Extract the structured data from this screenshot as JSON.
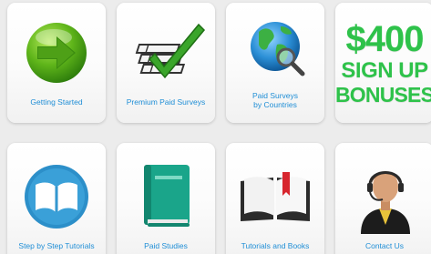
{
  "tiles_row1": [
    {
      "label": "Getting Started",
      "icon": "arrow-right-icon"
    },
    {
      "label": "Premium Paid Surveys",
      "icon": "checklist-icon"
    },
    {
      "label": "Paid Surveys\nby Countries",
      "icon": "globe-magnifier-icon"
    },
    {
      "headline": "$400",
      "line2": "SIGN UP",
      "line3": "BONUSES"
    }
  ],
  "tiles_row2": [
    {
      "label": "Step by Step Tutorials",
      "icon": "open-book-circle-icon"
    },
    {
      "label": "Paid Studies",
      "icon": "green-book-icon"
    },
    {
      "label": "Tutorials and Books",
      "icon": "bookmark-book-icon"
    },
    {
      "label": "Contact Us",
      "icon": "support-agent-icon"
    }
  ],
  "colors": {
    "label_blue": "#1f8ed6",
    "bonus_green": "#2ec24a",
    "tile_bg": "#ffffff",
    "page_bg": "#ececec"
  }
}
